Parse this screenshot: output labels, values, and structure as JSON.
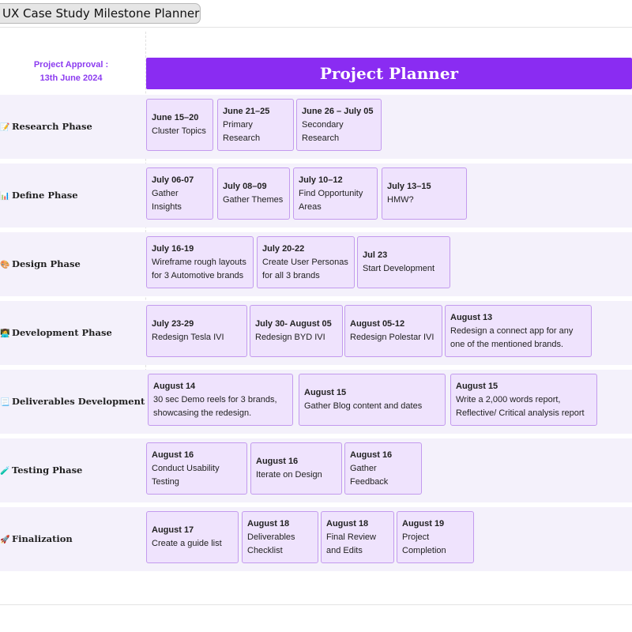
{
  "window": {
    "title": "UX Case Study Milestone Planner"
  },
  "approval": {
    "line1": "Project Approval :",
    "line2": "13th June 2024"
  },
  "banner": {
    "title": "Project Planner"
  },
  "colors": {
    "accent": "#8a2cf2",
    "card_fill": "#efe3fd",
    "card_border": "#c39aee",
    "band": "#f4f1fb"
  },
  "phases": [
    {
      "label": "Research Phase",
      "icon": "memo-icon",
      "glyph": "📝",
      "cards": [
        {
          "date": "June 15–20",
          "task": "Cluster Topics"
        },
        {
          "date": "June 21–25",
          "task": "Primary Research"
        },
        {
          "date": "June 26 – July 05",
          "task": "Secondary Research"
        }
      ]
    },
    {
      "label": "Define  Phase",
      "icon": "bar-chart-icon",
      "glyph": "📊",
      "cards": [
        {
          "date": "July 06-07",
          "task": "Gather Insights"
        },
        {
          "date": "July 08–09",
          "task": "Gather Themes"
        },
        {
          "date": "July 10–12",
          "task": "Find Opportunity Areas"
        },
        {
          "date": "July 13–15",
          "task": "HMW?"
        }
      ]
    },
    {
      "label": "Design Phase",
      "icon": "palette-icon",
      "glyph": "🎨",
      "cards": [
        {
          "date": "July 16-19",
          "task": "Wireframe rough layouts for 3 Automotive brands"
        },
        {
          "date": "July 20-22",
          "task": "Create User Personas for all 3 brands"
        },
        {
          "date": "Jul 23",
          "task": "Start Development"
        }
      ]
    },
    {
      "label": "Development Phase",
      "icon": "technologist-icon",
      "glyph": "👩‍💻",
      "cards": [
        {
          "date": "July 23-29",
          "task": "Redesign Tesla IVI"
        },
        {
          "date": "July 30- August 05",
          "task": "Redesign BYD IVI"
        },
        {
          "date": "August 05-12",
          "task": "Redesign Polestar IVI"
        },
        {
          "date": "August 13",
          "task": "Redesign a connect app for any one of the mentioned brands."
        }
      ]
    },
    {
      "label": "Deliverables Development",
      "icon": "document-icon",
      "glyph": "📃",
      "cards": [
        {
          "date": "August 14",
          "task": "30 sec Demo reels for 3 brands, showcasing the redesign."
        },
        {
          "date": "August 15",
          "task": "Gather Blog content and dates"
        },
        {
          "date": "August 15",
          "task": "Write a 2,000 words report, Reflective/ Critical analysis report"
        }
      ]
    },
    {
      "label": "Testing Phase",
      "icon": "test-tube-icon",
      "glyph": "🧪",
      "cards": [
        {
          "date": "August 16",
          "task": "Conduct Usability Testing"
        },
        {
          "date": "August 16",
          "task": "Iterate on Design"
        },
        {
          "date": "August 16",
          "task": "Gather Feedback"
        }
      ]
    },
    {
      "label": "Finalization",
      "icon": "rocket-icon",
      "glyph": "🚀",
      "cards": [
        {
          "date": "August 17",
          "task": "Create a guide list"
        },
        {
          "date": "August 18",
          "task": "Deliverables Checklist"
        },
        {
          "date": "August 18",
          "task": "Final Review and Edits"
        },
        {
          "date": "August 19",
          "task": "Project Completion"
        }
      ]
    }
  ]
}
